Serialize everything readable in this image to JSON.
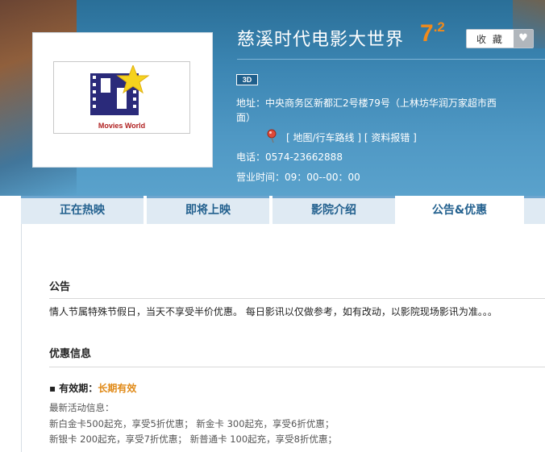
{
  "cinema": {
    "name": "慈溪时代电影大世界",
    "rating_int": "7",
    "rating_dec": ".2",
    "favorite_label": "收 藏",
    "logo_text": "Movies World",
    "badge": "3D",
    "address_line1": "地址：中央商务区新都汇2号楼79号（上林坊华润万家超市西",
    "address_line2": "面）",
    "map_link": "[ 地图/行车路线 ]",
    "report_link": "[ 资料报错 ]",
    "phone": "电话：0574-23662888",
    "hours": "营业时间：09：00--00：00"
  },
  "tabs": [
    {
      "label": "正在热映"
    },
    {
      "label": "即将上映"
    },
    {
      "label": "影院介绍"
    },
    {
      "label": "公告&优惠"
    }
  ],
  "content": {
    "notice_title": "公告",
    "notice_text": "情人节属特殊节假日，当天不享受半价优惠。 每日影讯以仅做参考，如有改动，以影院现场影讯为准。。。",
    "offers_title": "优惠信息",
    "validity_label": "▪ 有效期：",
    "validity_value": "长期有效",
    "promo_lines": [
      "最新活动信息：",
      "新白金卡500起充，享受5折优惠；   新金卡 300起充，享受6折优惠；",
      "新银卡 200起充，享受7折优惠；   新普通卡 100起充，享受8折优惠；"
    ]
  },
  "colors": {
    "header_blue": "#3c86b3",
    "tab_text": "#23618f",
    "rating_orange": "#f08a1c",
    "validity_orange": "#e08a18"
  },
  "icons": [
    "star-icon",
    "film-strip-icon",
    "heart-icon",
    "map-pin-icon"
  ]
}
